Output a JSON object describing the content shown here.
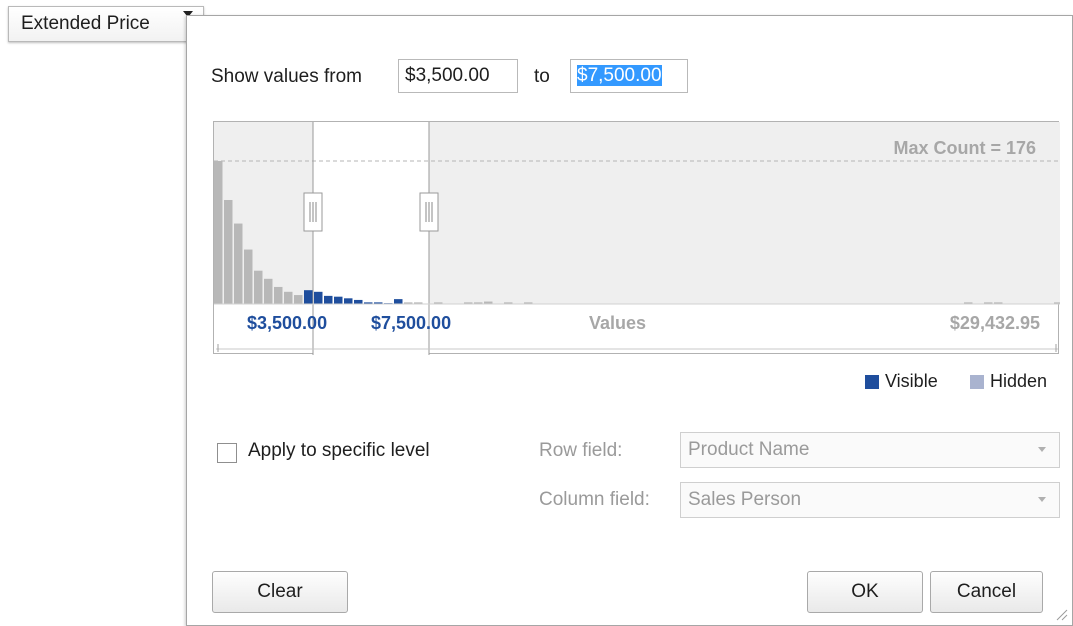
{
  "field_header": {
    "label": "Extended Price",
    "icon": "filter-icon"
  },
  "range": {
    "from_label": "Show values from",
    "from_value": "$3,500.00",
    "to_label": "to",
    "to_value": "$7,500.00"
  },
  "histogram": {
    "max_count_label": "Max Count = 176",
    "from_value_label": "$3,500.00",
    "to_value_label": "$7,500.00",
    "axis_label": "Values",
    "max_value_label": "$29,432.95"
  },
  "chart_data": {
    "type": "bar",
    "max_count": 176,
    "selected_bins": [
      9,
      18
    ],
    "values": [
      176,
      128,
      99,
      67,
      41,
      31,
      21,
      15,
      11,
      17,
      15,
      10,
      9,
      7,
      5,
      2,
      2,
      1,
      6,
      2,
      2,
      0,
      2,
      0,
      0,
      2,
      2,
      3,
      0,
      2,
      0,
      2,
      0,
      0,
      0,
      0,
      0,
      0,
      0,
      0,
      0,
      0,
      0,
      0,
      0,
      0,
      0,
      0,
      0,
      0,
      0,
      0,
      0,
      0,
      0,
      0,
      0,
      0,
      0,
      0,
      0,
      0,
      0,
      0,
      0,
      0,
      0,
      0,
      0,
      0,
      0,
      0,
      0,
      0,
      0,
      2,
      0,
      2,
      2,
      0,
      0,
      0,
      0,
      0,
      2
    ],
    "colors": {
      "visible": "#1f4e9d",
      "hidden": "#b8b8b8"
    },
    "legend": [
      "Visible",
      "Hidden"
    ]
  },
  "legend": {
    "visible_label": "Visible",
    "hidden_label": "Hidden"
  },
  "level": {
    "checkbox_label": "Apply to specific level",
    "row_field_label": "Row field:",
    "row_field_value": "Product Name",
    "column_field_label": "Column field:",
    "column_field_value": "Sales Person"
  },
  "buttons": {
    "clear": "Clear",
    "ok": "OK",
    "cancel": "Cancel"
  }
}
